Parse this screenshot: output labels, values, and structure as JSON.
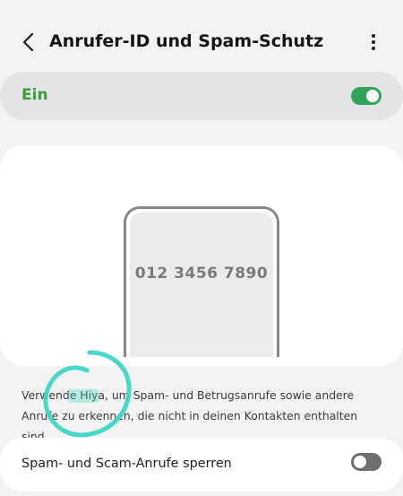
{
  "header": {
    "title": "Anrufer-ID und Spam-Schutz",
    "back_icon": "chevron-left-icon",
    "more_icon": "more-vertical-icon"
  },
  "master_switch": {
    "label": "Ein",
    "state": true,
    "accent_color": "#31a35a"
  },
  "illustration": {
    "phone_number": "012 3456 7890"
  },
  "description": {
    "text": "Verwende Hiya, um Spam- und Betrugsanrufe sowie andere Anrufe zu erkennen, die nicht in deinen Kontakten enthalten sind."
  },
  "spam_block": {
    "label": "Spam- und Scam-Anrufe sperren",
    "state": false
  },
  "annotation": {
    "highlight_color": "#3fd6c4"
  }
}
